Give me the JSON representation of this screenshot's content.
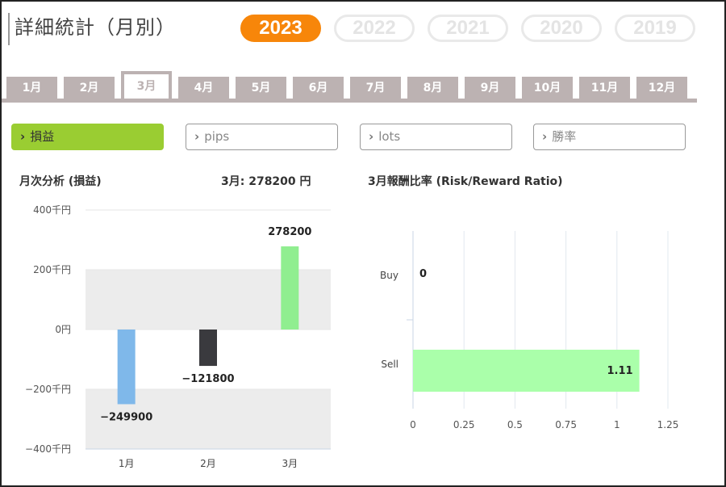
{
  "header": {
    "title": "詳細統計（月別）"
  },
  "years": [
    "2023",
    "2022",
    "2021",
    "2020",
    "2019"
  ],
  "months": [
    "1月",
    "2月",
    "3月",
    "4月",
    "5月",
    "6月",
    "7月",
    "8月",
    "9月",
    "10月",
    "11月",
    "12月"
  ],
  "filters": [
    "損益",
    "pips",
    "lots",
    "勝率"
  ],
  "left_panel": {
    "title": "月次分析 (損益)",
    "summary": "3月:  278200 円"
  },
  "right_panel": {
    "title": "3月報酬比率 (Risk/Reward Ratio)"
  },
  "chart_data": [
    {
      "type": "bar",
      "title": "月次分析 (損益)",
      "categories": [
        "1月",
        "2月",
        "3月"
      ],
      "values": [
        -249900,
        -121800,
        278200
      ],
      "value_labels": [
        "−249900",
        "−121800",
        "278200"
      ],
      "colors": [
        "#7fb8ea",
        "#3a3a3e",
        "#90ee90"
      ],
      "ylim": [
        -400000,
        400000
      ],
      "yticks": [
        {
          "v": 400000,
          "label": "400千円"
        },
        {
          "v": 200000,
          "label": "200千円"
        },
        {
          "v": 0,
          "label": "0円"
        },
        {
          "v": -200000,
          "label": "−200千円"
        },
        {
          "v": -400000,
          "label": "−400千円"
        }
      ],
      "band_color": "#ececec"
    },
    {
      "type": "bar",
      "orientation": "horizontal",
      "title": "3月報酬比率 (Risk/Reward Ratio)",
      "categories": [
        "Buy",
        "Sell"
      ],
      "values": [
        0,
        1.11
      ],
      "value_labels": [
        "0",
        "1.11"
      ],
      "color": "#aaffaa",
      "xlim": [
        0,
        1.25
      ],
      "xticks": [
        "0",
        "0.25",
        "0.5",
        "0.75",
        "1",
        "1.25"
      ],
      "grid": true
    }
  ]
}
